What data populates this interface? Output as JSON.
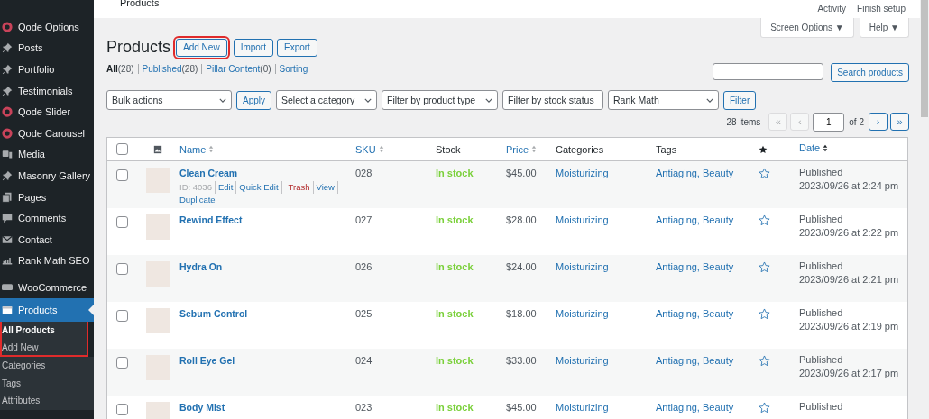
{
  "sidebar": {
    "items": [
      {
        "label": "Qode Options",
        "kind": "qode",
        "selected": false
      },
      {
        "label": "Posts",
        "kind": "pin",
        "selected": false
      },
      {
        "label": "Portfolio",
        "kind": "pin",
        "selected": false
      },
      {
        "label": "Testimonials",
        "kind": "pin",
        "selected": false
      },
      {
        "label": "Qode Slider",
        "kind": "qode",
        "selected": false
      },
      {
        "label": "Qode Carousel",
        "kind": "qode",
        "selected": false
      },
      {
        "label": "Media",
        "kind": "media",
        "selected": false
      },
      {
        "label": "Masonry Gallery",
        "kind": "pin",
        "selected": false
      },
      {
        "label": "Pages",
        "kind": "pages",
        "selected": false
      },
      {
        "label": "Comments",
        "kind": "comments",
        "selected": false
      },
      {
        "label": "Contact",
        "kind": "mail",
        "selected": false
      },
      {
        "label": "Rank Math SEO",
        "kind": "chart",
        "selected": false
      },
      {
        "label": "WooCommerce",
        "kind": "woo",
        "selected": false
      },
      {
        "label": "Products",
        "kind": "products",
        "selected": true,
        "highlighted": true,
        "children": [
          {
            "label": "All Products",
            "selected": true,
            "highlighted": true
          },
          {
            "label": "Add New",
            "selected": false,
            "highlighted": true
          },
          {
            "label": "Categories",
            "selected": false,
            "highlighted": false
          },
          {
            "label": "Tags",
            "selected": false,
            "highlighted": false
          },
          {
            "label": "Attributes",
            "selected": false,
            "highlighted": false
          }
        ]
      }
    ]
  },
  "topbar": {
    "title": "Products",
    "actions": [
      "Activity",
      "Finish setup"
    ]
  },
  "screen_meta": [
    "Screen Options ▼",
    "Help ▼"
  ],
  "page": {
    "title": "Products",
    "buttons": [
      {
        "label": "Add New",
        "highlighted": true
      },
      {
        "label": "Import",
        "highlighted": false
      },
      {
        "label": "Export",
        "highlighted": false
      }
    ]
  },
  "views": [
    {
      "label": "All",
      "count": "(28)",
      "selected": true
    },
    {
      "label": "Published",
      "count": "(28)",
      "selected": false
    },
    {
      "label": "Pillar Content",
      "count": "(0)",
      "selected": false
    },
    {
      "label": "Sorting",
      "selected": false
    }
  ],
  "search": {
    "button": "Search products"
  },
  "filters": {
    "selects": [
      {
        "label": "Bulk actions",
        "kind": "select"
      },
      {
        "label": "Apply",
        "kind": "button"
      },
      {
        "label": "Select a category",
        "kind": "select"
      },
      {
        "label": "Filter by product type",
        "kind": "select"
      },
      {
        "label": "Filter by stock status",
        "kind": "select"
      },
      {
        "label": "Rank Math",
        "kind": "select"
      },
      {
        "label": "Filter",
        "kind": "button"
      }
    ]
  },
  "pagination": {
    "count": "28 items",
    "first": "«",
    "prev": "‹",
    "page": "1",
    "of": "of 2",
    "next": "›",
    "last": "»"
  },
  "table": {
    "select_all_checked": false,
    "columns": [
      {
        "label": "Name",
        "sortable": true
      },
      {
        "label": "SKU",
        "sortable": true
      },
      {
        "label": "Stock",
        "sortable": false
      },
      {
        "label": "Price",
        "sortable": true
      },
      {
        "label": "Categories",
        "sortable": false
      },
      {
        "label": "Tags",
        "sortable": false
      },
      {
        "label": "Date",
        "sortable": true
      }
    ],
    "rows": [
      {
        "checked": false,
        "name": "Clean Cream",
        "sku": "028",
        "stock": "In stock",
        "price": "$45.00",
        "categories": "Moisturizing",
        "tags": "Antiaging, Beauty",
        "featured": false,
        "status": "Published",
        "date": "2023/09/26 at 2:24 pm",
        "actions": [
          {
            "text": "ID: 4036",
            "kind": "id"
          },
          {
            "text": "Edit",
            "kind": "link"
          },
          {
            "text": "Quick Edit",
            "kind": "link"
          },
          {
            "text": "Trash",
            "kind": "trash"
          },
          {
            "text": "View",
            "kind": "link"
          },
          {
            "text": "Duplicate",
            "kind": "link"
          }
        ]
      },
      {
        "checked": false,
        "name": "Rewind Effect",
        "sku": "027",
        "stock": "In stock",
        "price": "$28.00",
        "categories": "Moisturizing",
        "tags": "Antiaging, Beauty",
        "featured": false,
        "status": "Published",
        "date": "2023/09/26 at 2:22 pm"
      },
      {
        "checked": false,
        "name": "Hydra On",
        "sku": "026",
        "stock": "In stock",
        "price": "$24.00",
        "categories": "Moisturizing",
        "tags": "Antiaging, Beauty",
        "featured": false,
        "status": "Published",
        "date": "2023/09/26 at 2:21 pm"
      },
      {
        "checked": false,
        "name": "Sebum Control",
        "sku": "025",
        "stock": "In stock",
        "price": "$18.00",
        "categories": "Moisturizing",
        "tags": "Antiaging, Beauty",
        "featured": false,
        "status": "Published",
        "date": "2023/09/26 at 2:19 pm"
      },
      {
        "checked": false,
        "name": "Roll Eye Gel",
        "sku": "024",
        "stock": "In stock",
        "price": "$33.00",
        "categories": "Moisturizing",
        "tags": "Antiaging, Beauty",
        "featured": false,
        "status": "Published",
        "date": "2023/09/26 at 2:17 pm"
      },
      {
        "checked": false,
        "name": "Body Mist",
        "sku": "023",
        "stock": "In stock",
        "price": "$45.00",
        "categories": "Moisturizing",
        "tags": "Antiaging, Beauty",
        "featured": false,
        "status": "Published"
      }
    ]
  }
}
